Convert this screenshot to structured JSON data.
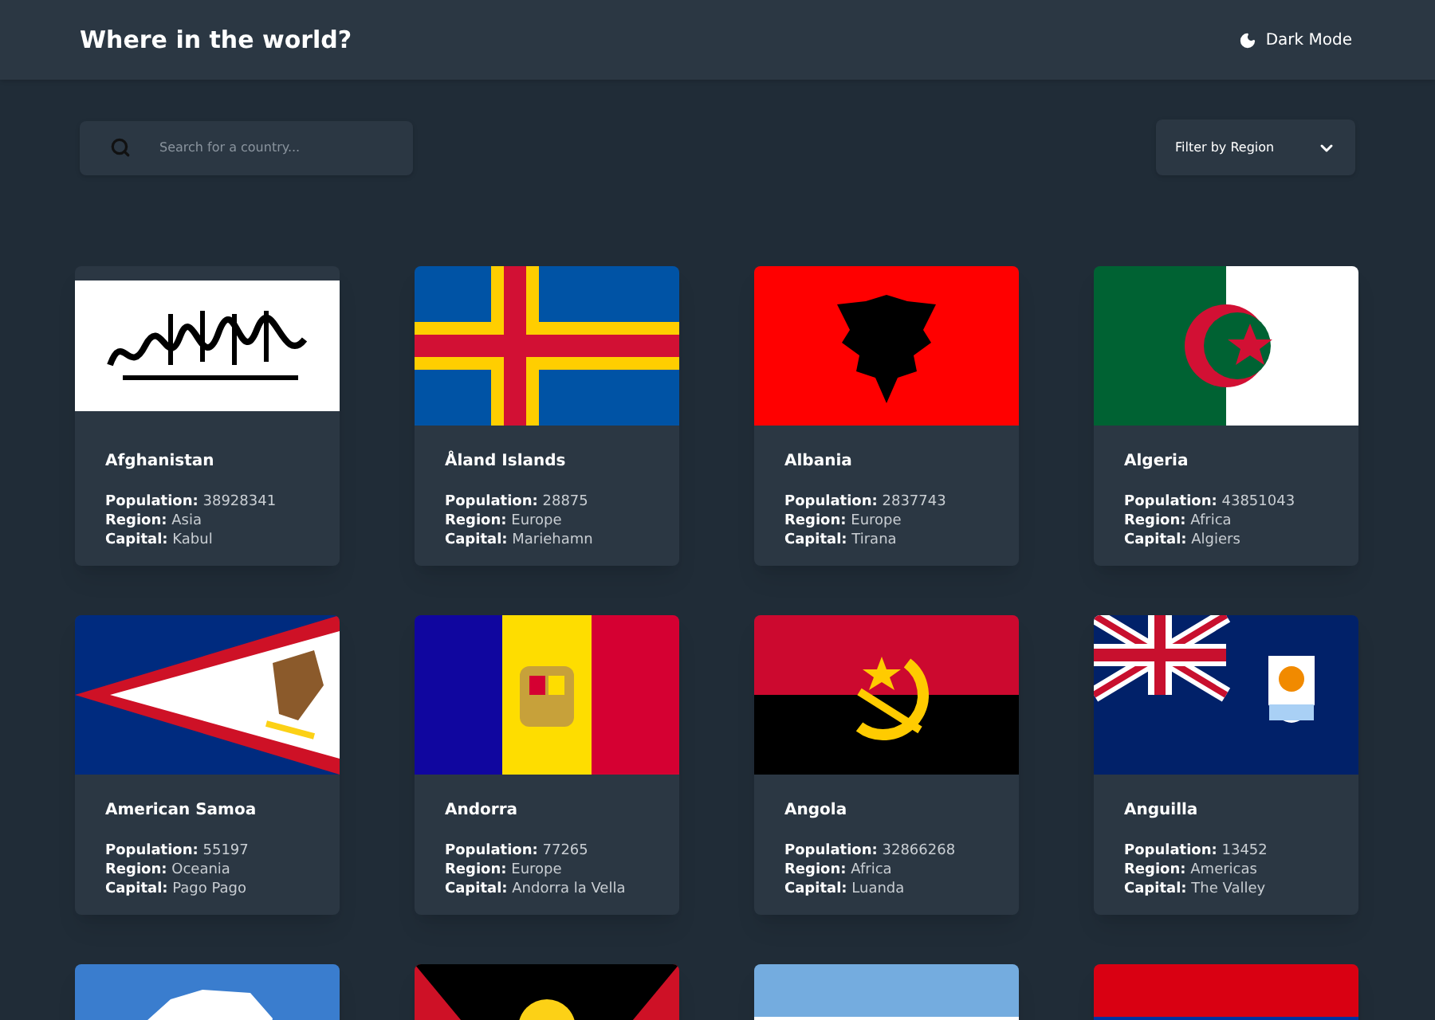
{
  "header": {
    "title": "Where in the world?",
    "theme_toggle": "Dark Mode"
  },
  "search": {
    "placeholder": "Search for a country..."
  },
  "filter": {
    "label": "Filter by Region"
  },
  "countries": [
    {
      "kind": "script",
      "name": "Afghanistan",
      "population_label": "Population:",
      "population": "38928341",
      "region_label": "Region:",
      "region": "Asia",
      "capital_label": "Capital:",
      "capital": "Kabul"
    },
    {
      "kind": "nordic-cross",
      "name": "Åland Islands",
      "population_label": "Population:",
      "population": "28875",
      "region_label": "Region:",
      "region": "Europe",
      "capital_label": "Capital:",
      "capital": "Mariehamn"
    },
    {
      "kind": "eagle",
      "name": "Albania",
      "population_label": "Population:",
      "population": "2837743",
      "region_label": "Region:",
      "region": "Europe",
      "capital_label": "Capital:",
      "capital": "Tirana"
    },
    {
      "kind": "crescent",
      "name": "Algeria",
      "population_label": "Population:",
      "population": "43851043",
      "region_label": "Region:",
      "region": "Africa",
      "capital_label": "Capital:",
      "capital": "Algiers"
    },
    {
      "kind": "triangle",
      "name": "American Samoa",
      "population_label": "Population:",
      "population": "55197",
      "region_label": "Region:",
      "region": "Oceania",
      "capital_label": "Capital:",
      "capital": "Pago Pago"
    },
    {
      "kind": "tricolor",
      "name": "Andorra",
      "population_label": "Population:",
      "population": "77265",
      "region_label": "Region:",
      "region": "Europe",
      "capital_label": "Capital:",
      "capital": "Andorra la Vella"
    },
    {
      "kind": "emblem-bicolor",
      "name": "Angola",
      "population_label": "Population:",
      "population": "32866268",
      "region_label": "Region:",
      "region": "Africa",
      "capital_label": "Capital:",
      "capital": "Luanda"
    },
    {
      "kind": "ensign",
      "name": "Anguilla",
      "population_label": "Population:",
      "population": "13452",
      "region_label": "Region:",
      "region": "Americas",
      "capital_label": "Capital:",
      "capital": "The Valley"
    },
    {
      "kind": "map"
    },
    {
      "kind": "sun"
    },
    {
      "kind": "stripes"
    },
    {
      "kind": "red-blue"
    }
  ]
}
